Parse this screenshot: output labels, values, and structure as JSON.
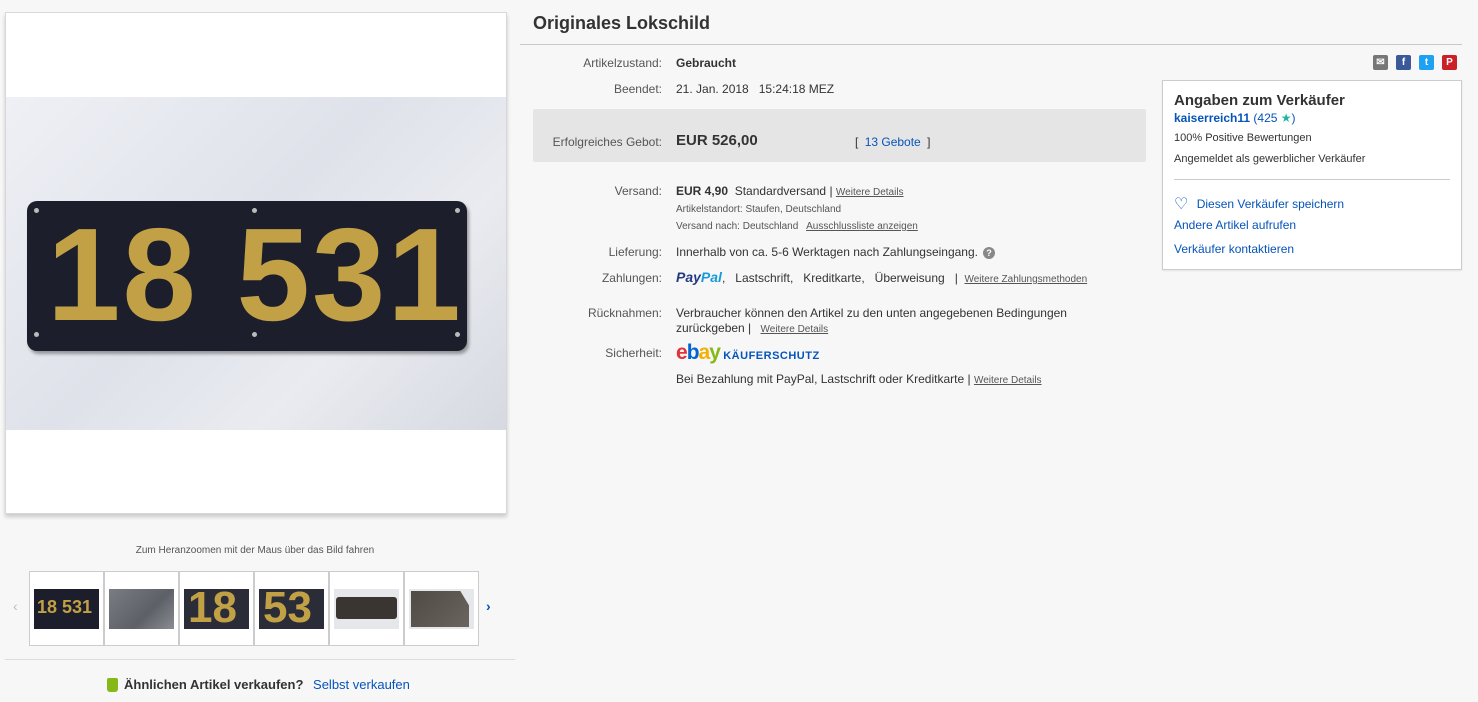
{
  "item": {
    "title": "Originales Lokschild",
    "plate_text": "18 531"
  },
  "gallery": {
    "zoom_hint": "Zum Heranzoomen mit der Maus über das Bild fahren",
    "thumbs": [
      "18 531",
      "",
      "18",
      "53",
      "",
      ""
    ]
  },
  "details": {
    "condition_label": "Artikelzustand:",
    "condition_value": "Gebraucht",
    "ended_label": "Beendet:",
    "ended_value": "21. Jan. 2018   15:24:18 MEZ",
    "bid_label": "Erfolgreiches Gebot:",
    "bid_value": "EUR 526,00",
    "bids_open": "[",
    "bids_link": "13 Gebote",
    "bids_close": "]",
    "shipping_label": "Versand:",
    "shipping_price": "EUR 4,90",
    "shipping_method": "Standardversand",
    "shipping_sep": "|",
    "shipping_more": "Weitere Details",
    "location_label": "Artikelstandort:",
    "location_value": "Staufen, Deutschland",
    "shipto_label": "Versand nach:",
    "shipto_value": "Deutschland",
    "exclusion_link": "Ausschlussliste anzeigen",
    "delivery_label": "Lieferung:",
    "delivery_value": "Innerhalb von ca. 5-6 Werktagen nach Zahlungseingang.",
    "help_glyph": "?",
    "payment_label": "Zahlungen:",
    "paypal_a": "Pay",
    "paypal_b": "Pal",
    "payment_methods": ",   Lastschrift,   Kreditkarte,   Überweisung   |",
    "payment_more": "Weitere Zahlungsmethoden",
    "returns_label": "Rücknahmen:",
    "returns_value_1": "Verbraucher können den Artikel zu den unten angegebenen Bedingungen",
    "returns_value_2": "zurückgeben  |",
    "returns_more": "Weitere Details",
    "security_label": "Sicherheit:",
    "ebay_e": "e",
    "ebay_b": "b",
    "ebay_a": "a",
    "ebay_y": "y",
    "buyer_protection": "KÄUFERSCHUTZ",
    "security_value": "Bei Bezahlung mit PayPal, Lastschrift oder Kreditkarte |",
    "security_more": "Weitere Details"
  },
  "share": {
    "email": "✉",
    "facebook": "f",
    "twitter": "t",
    "pinterest": "P",
    "colors": {
      "email": "#777777",
      "facebook": "#3b5998",
      "twitter": "#1da1f2",
      "pinterest": "#cb2027"
    }
  },
  "seller": {
    "heading": "Angaben zum Verkäufer",
    "name": "kaiserreich11",
    "rating_open": " (425 ",
    "rating_star": "★",
    "rating_close": ")",
    "positive": "100% Positive Bewertungen",
    "business": "Angemeldet als gewerblicher Verkäufer",
    "heart": "♡",
    "save": "Diesen Verkäufer speichern",
    "other_items": "Andere Artikel aufrufen",
    "contact": "Verkäufer kontaktieren"
  },
  "sell_similar": {
    "question": "Ähnlichen Artikel verkaufen?",
    "link": "Selbst verkaufen"
  },
  "nav": {
    "prev": "‹",
    "next": "›"
  }
}
